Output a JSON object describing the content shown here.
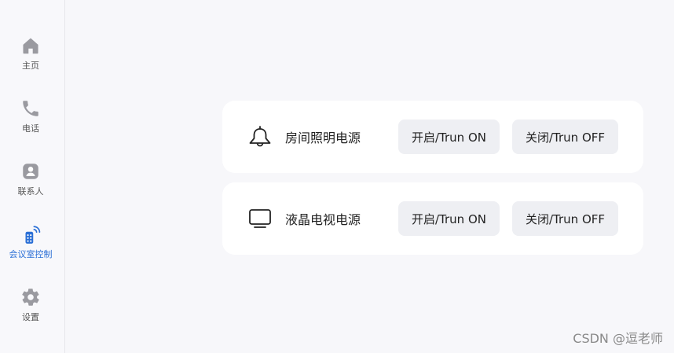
{
  "sidebar": {
    "items": [
      {
        "label": "主页",
        "icon": "home-icon"
      },
      {
        "label": "电话",
        "icon": "phone-icon"
      },
      {
        "label": "联系人",
        "icon": "contacts-icon"
      },
      {
        "label": "会议室控制",
        "icon": "remote-control-icon",
        "active": true
      },
      {
        "label": "设置",
        "icon": "settings-icon"
      }
    ]
  },
  "devices": [
    {
      "name": "房间照明电源",
      "icon": "lamp-icon",
      "on_label": "开启/Trun ON",
      "off_label": "关闭/Trun OFF"
    },
    {
      "name": "液晶电视电源",
      "icon": "tv-icon",
      "on_label": "开启/Trun ON",
      "off_label": "关闭/Trun OFF"
    }
  ],
  "watermark": "CSDN @逗老师",
  "colors": {
    "accent": "#2b6fd6",
    "icon_gray": "#9a9aa0",
    "button_bg": "#eeeff3"
  }
}
